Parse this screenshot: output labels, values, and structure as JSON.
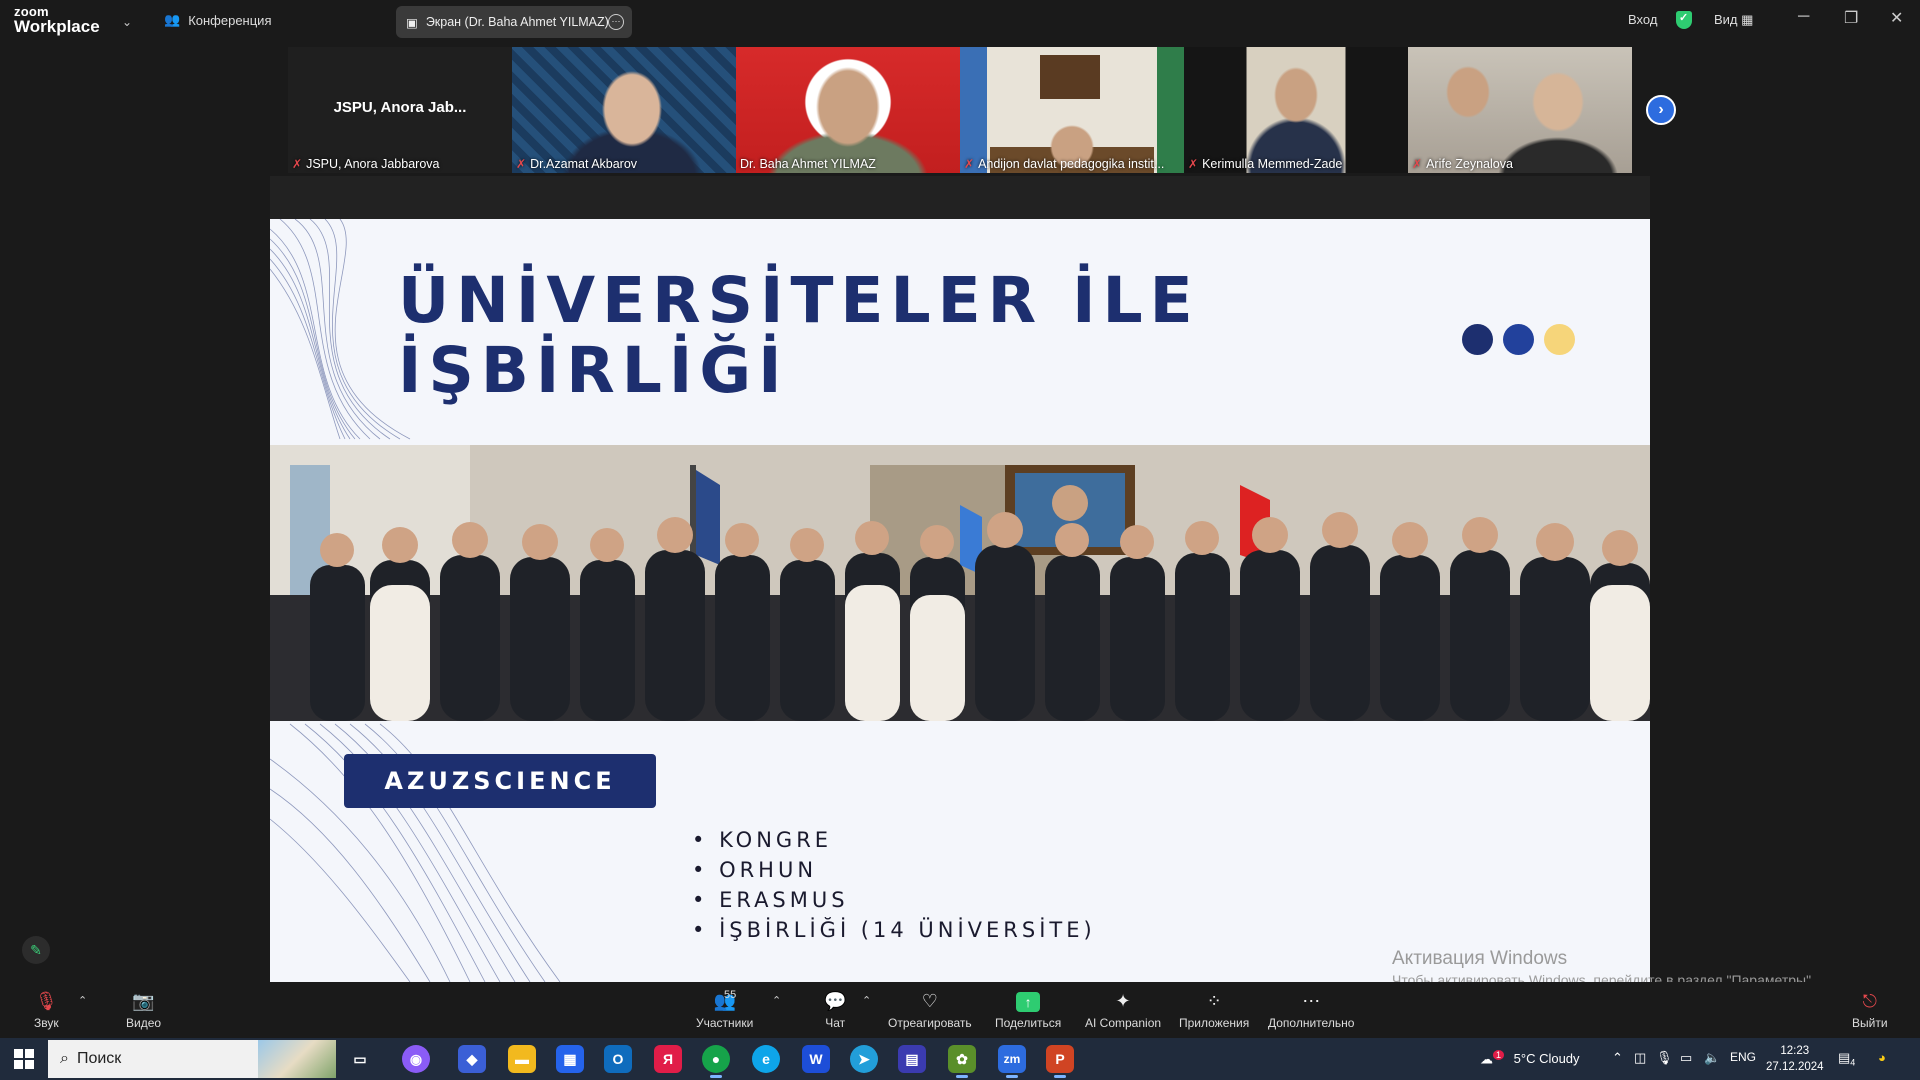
{
  "titlebar": {
    "logo_top": "zoom",
    "logo_bottom": "Workplace",
    "meeting_label": "Конференция",
    "screen_share_label": "Экран (Dr. Baha Ahmet YILMAZ)",
    "signin_label": "Вход",
    "view_label": "Вид"
  },
  "gallery": {
    "tiles": [
      {
        "name": "JSPU, Anora Jabbarova",
        "big_name": "JSPU, Anora Jab...",
        "muted": true
      },
      {
        "name": "Dr.Azamat Akbarov",
        "muted": true
      },
      {
        "name": "Dr. Baha Ahmet YILMAZ",
        "muted": false,
        "active": true
      },
      {
        "name": "Andijon davlat pedagogika instit...",
        "muted": true
      },
      {
        "name": "Kerimulla Memmed-Zade",
        "muted": true
      },
      {
        "name": "Arife Zeynalova",
        "muted": true
      }
    ]
  },
  "slide": {
    "title_line1": "ÜNİVERSİTELER İLE",
    "title_line2": "İŞBİRLİĞİ",
    "tag": "AZUZSCIENCE",
    "bullets": [
      "KONGRE",
      "ORHUN",
      "ERASMUS",
      "İŞBİRLİĞİ (14 ÜNİVERSİTE)"
    ],
    "dot_colors": [
      "#1d2f6f",
      "#22419c",
      "#f6d57a"
    ]
  },
  "watermark": {
    "line1": "Активация Windows",
    "line2": "Чтобы активировать Windows, перейдите в раздел \"Параметры\"."
  },
  "toolbar": {
    "audio": "Звук",
    "video": "Видео",
    "participants": "Участники",
    "participants_count": "55",
    "chat": "Чат",
    "react": "Отреагировать",
    "share": "Поделиться",
    "ai": "AI Companion",
    "apps": "Приложения",
    "more": "Дополнительно",
    "leave": "Выйти"
  },
  "taskbar": {
    "search_placeholder": "Поиск",
    "weather": "5°C  Cloudy",
    "weather_badge": "1",
    "lang": "ENG",
    "time": "12:23",
    "date": "27.12.2024",
    "notif_count": "4"
  },
  "colors": {
    "accent_green": "#2ecc71",
    "slide_navy": "#1d2f6f",
    "muted_red": "#e5484d"
  }
}
